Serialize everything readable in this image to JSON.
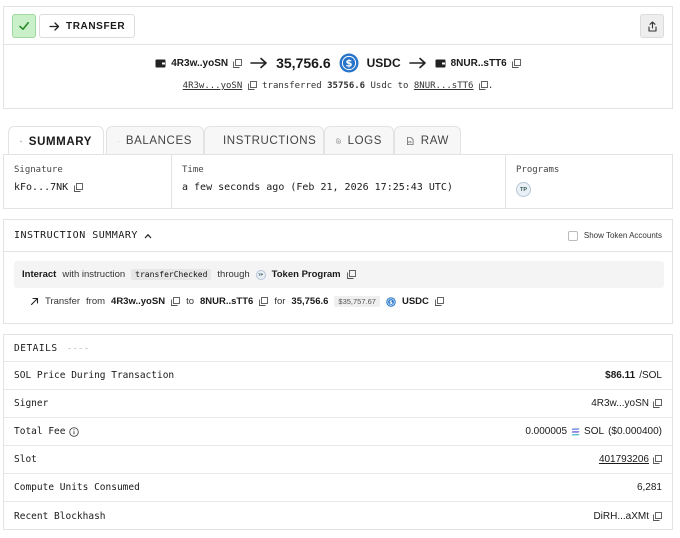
{
  "header": {
    "tx_type_label": "TRANSFER"
  },
  "hero": {
    "from_account": "4R3w..yoSN",
    "amount": "35,756.6",
    "token_symbol": "USDC",
    "to_account": "8NUR..sTT6",
    "sub_from": "4R3w...yoSN",
    "sub_verb": "transferred",
    "sub_amount": "35756.6",
    "sub_token": "Usdc",
    "sub_to_word": "to",
    "sub_to": "8NUR...sTT6",
    "sub_period": "."
  },
  "tabs": [
    {
      "label": "SUMMARY",
      "icon": "list-check-icon",
      "active": true
    },
    {
      "label": "BALANCES",
      "icon": "list-icon",
      "active": false
    },
    {
      "label": "INSTRUCTIONS",
      "icon": "instructions-icon",
      "active": false
    },
    {
      "label": "LOGS",
      "icon": "document-icon",
      "active": false
    },
    {
      "label": "RAW",
      "icon": "code-file-icon",
      "active": false
    }
  ],
  "summary": {
    "signature_label": "Signature",
    "signature_value": "kFo...7NK",
    "time_label": "Time",
    "time_value": "a few seconds ago (Feb 21, 2026 17:25:43 UTC)",
    "programs_label": "Programs",
    "program_badge": "TP"
  },
  "instruction_summary": {
    "title": "INSTRUCTION SUMMARY",
    "show_token_accounts_label": "Show Token Accounts",
    "interact_word": "Interact",
    "with_instruction": "with instruction",
    "instruction_name": "transferChecked",
    "through_word": "through",
    "program_badge": "TP",
    "program_name": "Token Program",
    "transfer_word": "Transfer",
    "from_word": "from",
    "from_account": "4R3w..yoSN",
    "to_word": "to",
    "to_account": "8NUR..sTT6",
    "for_word": "for",
    "amount": "35,756.6",
    "usd_value": "$35,757.67",
    "token_symbol": "USDC"
  },
  "details": {
    "title": "DETAILS",
    "rows": [
      {
        "label": "SOL Price During Transaction",
        "value": "$86.11",
        "suffix": "/SOL"
      },
      {
        "label": "Signer",
        "value": "4R3w...yoSN"
      },
      {
        "label": "Total Fee",
        "value": "0.000005",
        "token": "SOL",
        "usd": "($0.000400)"
      },
      {
        "label": "Slot",
        "value": "401793206"
      },
      {
        "label": "Compute Units Consumed",
        "value": "6,281"
      },
      {
        "label": "Recent Blockhash",
        "value": "DiRH...aXMt"
      }
    ]
  },
  "colors": {
    "success_bg": "#c9f0c9",
    "usdc_blue": "#2775ca",
    "border": "#e3e3e3"
  }
}
